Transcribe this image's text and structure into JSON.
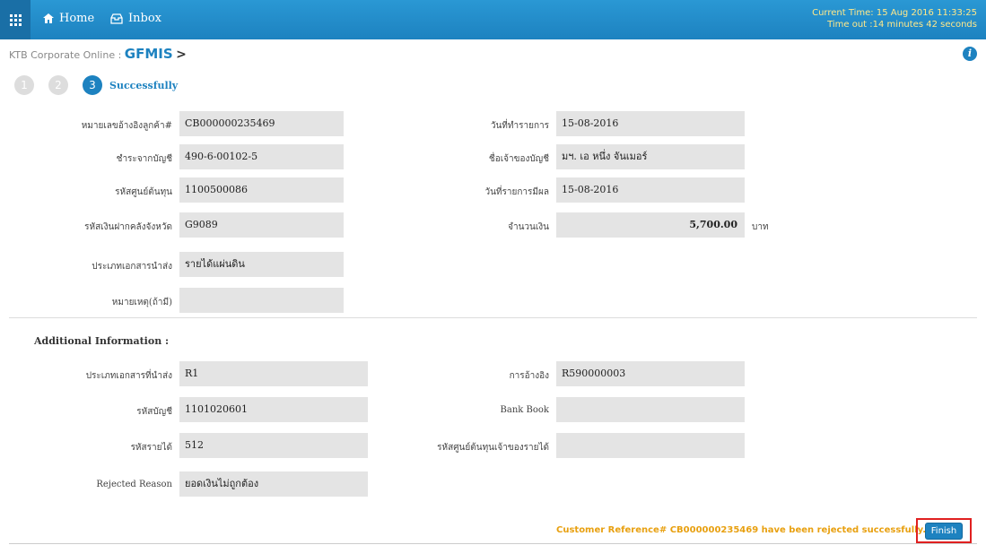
{
  "header": {
    "home_label": "Home",
    "inbox_label": "Inbox",
    "current_time": "Current Time: 15 Aug 2016 11:33:25",
    "timeout": "Time out :14 minutes 42 seconds"
  },
  "breadcrumb": {
    "prefix": "KTB Corporate Online :",
    "current": "GFMIS",
    "sep": ">"
  },
  "steps": {
    "items": [
      "1",
      "2",
      "3"
    ],
    "active_label": "Successfully"
  },
  "form": {
    "left": [
      {
        "label": "หมายเลขอ้างอิงลูกค้า#",
        "value": "CB000000235469"
      },
      {
        "label": "ชำระจากบัญชี",
        "value": "490-6-00102-5"
      },
      {
        "label": "รหัสศูนย์ต้นทุน",
        "value": "1100500086"
      },
      {
        "label": "รหัสเงินฝากคลังจังหวัด",
        "value": "G9089"
      },
      {
        "label": "ประเภทเอกสารนำส่ง",
        "value": "รายได้แผ่นดิน"
      },
      {
        "label": "หมายเหตุ(ถ้ามี)",
        "value": ""
      }
    ],
    "right": [
      {
        "label": "วันที่ทำรายการ",
        "value": "15-08-2016"
      },
      {
        "label": "ชื่อเจ้าของบัญชี",
        "value": "มฯ. เอ หนึ่ง จันเมอร์"
      },
      {
        "label": "วันที่รายการมีผล",
        "value": "15-08-2016"
      },
      {
        "label": "จำนวนเงิน",
        "value": "5,700.00",
        "unit": "บาท"
      }
    ]
  },
  "additional": {
    "title": "Additional Information :",
    "left": [
      {
        "label": "ประเภทเอกสารที่นำส่ง",
        "value": "R1"
      },
      {
        "label": "รหัสบัญชี",
        "value": "1101020601"
      },
      {
        "label": "รหัสรายได้",
        "value": "512"
      },
      {
        "label": "Rejected Reason",
        "value": "ยอดเงินไม่ถูกต้อง"
      }
    ],
    "right": [
      {
        "label": "การอ้างอิง",
        "value": "R590000003"
      },
      {
        "label": "Bank Book",
        "value": ""
      },
      {
        "label": "รหัสศูนย์ต้นทุนเจ้าของรายได้",
        "value": ""
      }
    ]
  },
  "footer": {
    "message": "Customer Reference# CB000000235469 have been rejected successfully.",
    "finish_label": "Finish"
  },
  "colors": {
    "accent": "#1d82c0",
    "warning": "#e8a010",
    "highlight": "#e02020"
  }
}
